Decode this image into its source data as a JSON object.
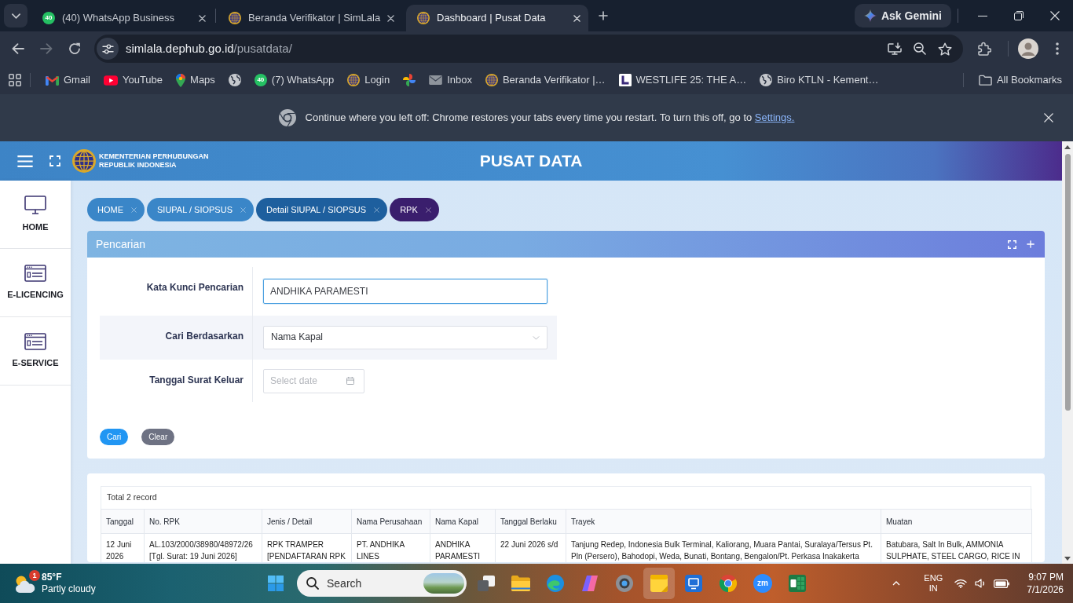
{
  "browser": {
    "tabs": [
      {
        "title": "(40) WhatsApp Business",
        "kind": "whatsapp",
        "badge": "40",
        "selected": false
      },
      {
        "title": "Beranda Verifikator | SimLala",
        "kind": "emblem",
        "selected": false
      },
      {
        "title": "Dashboard | Pusat Data",
        "kind": "emblem",
        "selected": true
      }
    ],
    "ask_button": "Ask Gemini",
    "url": "simlala.dephub.go.id/pusatdata/",
    "bookmarks": [
      {
        "label": "Gmail",
        "kind": "gmail"
      },
      {
        "label": "YouTube",
        "kind": "youtube"
      },
      {
        "label": "Maps",
        "kind": "maps"
      },
      {
        "kind": "globe"
      },
      {
        "label": "(7) WhatsApp",
        "kind": "whatsapp",
        "badge": "40"
      },
      {
        "label": "Login",
        "kind": "emblem"
      },
      {
        "kind": "pinwheel"
      },
      {
        "label": "Inbox",
        "kind": "mail"
      },
      {
        "label": "Beranda Verifikator |…",
        "kind": "emblem"
      },
      {
        "label": "WESTLIFE 25: THE A…",
        "kind": "square"
      },
      {
        "label": "Biro KTLN - Kement…",
        "kind": "globe"
      }
    ],
    "all_bookmarks": "All Bookmarks",
    "restore_bar": {
      "message": "Continue where you left off: Chrome restores your tabs every time you restart. To turn this off, go to",
      "link": "Settings."
    }
  },
  "app": {
    "logo_text": [
      "KEMENTERIAN PERHUBUNGAN",
      "REPUBLIK INDONESIA"
    ],
    "title": "PUSAT DATA",
    "sidebar": [
      {
        "label": "HOME",
        "kind": "monitor"
      },
      {
        "label": "E-LICENCING",
        "kind": "card"
      },
      {
        "label": "E-SERVICE",
        "kind": "card"
      }
    ],
    "breadcrumbs": [
      {
        "label": "HOME",
        "selected": false,
        "hovered": false
      },
      {
        "label": "SIUPAL / SIOPSUS",
        "selected": false,
        "hovered": false
      },
      {
        "label": "Detail SIUPAL / SIOPSUS",
        "selected": false,
        "hovered": true
      },
      {
        "label": "RPK",
        "selected": true,
        "hovered": false
      }
    ],
    "search_panel": {
      "title": "Pencarian",
      "fields": [
        {
          "kind": "text",
          "label": "Kata Kunci Pencarian",
          "value": "ANDHIKA PARAMESTI",
          "focused": true
        },
        {
          "kind": "select",
          "label": "Cari Berdasarkan",
          "value": "Nama Kapal"
        },
        {
          "kind": "date",
          "label": "Tanggal Surat Keluar",
          "placeholder": "Select date"
        }
      ],
      "buttons": [
        {
          "label": "Cari",
          "kind": "primary"
        },
        {
          "label": "Clear",
          "kind": "secondary"
        }
      ]
    },
    "results": {
      "summary": "Total 2 record",
      "columns": [
        "Tanggal",
        "No. RPK",
        "Jenis / Detail",
        "Nama Perusahaan",
        "Nama Kapal",
        "Tanggal Berlaku",
        "Trayek",
        "Muatan"
      ],
      "rows": [
        [
          "12 Juni 2026",
          "AL.103/2000/38980/48972/26 [Tgl. Surat: 19 Juni 2026]",
          "RPK TRAMPER [PENDAFTARAN RPK",
          "PT. ANDHIKA LINES",
          "ANDHIKA PARAMESTI",
          "22 Juni 2026 s/d",
          "Tanjung Redep, Indonesia Bulk Terminal, Kaliorang, Muara Pantai, Suralaya/Tersus Pt. Pln (Persero), Bahodopi, Weda, Bunati, Bontang, Bengalon/Pt. Perkasa Inakakerta",
          "Batubara, Salt In Bulk, AMMONIA SULPHATE, STEEL CARGO, RICE IN"
        ]
      ]
    }
  },
  "taskbar": {
    "weather": {
      "badge": "1",
      "temperature": "85°F",
      "condition": "Partly cloudy"
    },
    "search": {
      "placeholder": "Search"
    },
    "apps": [
      {
        "kind": "taskview",
        "selected": false
      },
      {
        "kind": "explorer",
        "selected": false
      },
      {
        "kind": "edge",
        "selected": false
      },
      {
        "kind": "copilot",
        "selected": false
      },
      {
        "kind": "camera",
        "selected": false
      },
      {
        "kind": "notes",
        "selected": true
      },
      {
        "kind": "remote",
        "selected": false
      },
      {
        "kind": "chrome",
        "selected": false
      },
      {
        "kind": "zoom",
        "label": "zm",
        "selected": false
      },
      {
        "kind": "excel",
        "selected": false
      }
    ],
    "language": [
      "ENG",
      "IN"
    ],
    "time": "9:07 PM",
    "date": "7/1/2026"
  }
}
